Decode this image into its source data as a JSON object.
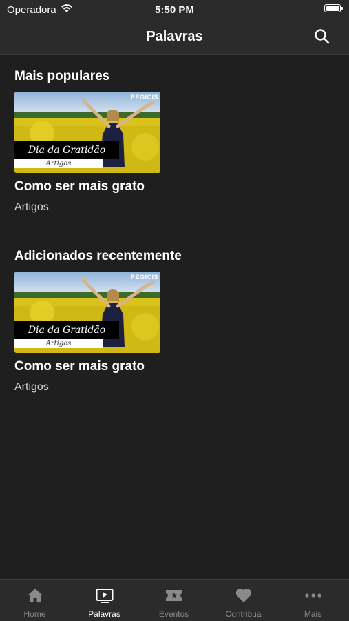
{
  "status_bar": {
    "carrier": "Operadora",
    "time": "5:50 PM"
  },
  "nav": {
    "title": "Palavras",
    "search_icon": "search-icon"
  },
  "sections": [
    {
      "title": "Mais populares",
      "items": [
        {
          "title": "Como ser mais grato",
          "category": "Artigos",
          "thumb_banner": "Dia da Gratidão",
          "thumb_sub": "Artigos",
          "thumb_logo": "PEGICIS"
        }
      ]
    },
    {
      "title": "Adicionados recentemente",
      "items": [
        {
          "title": "Como ser mais grato",
          "category": "Artigos",
          "thumb_banner": "Dia da Gratidão",
          "thumb_sub": "Artigos",
          "thumb_logo": "PEGICIS"
        }
      ]
    }
  ],
  "tab_bar": {
    "active": "Palavras",
    "tabs": [
      {
        "label": "Home",
        "icon": "home-icon"
      },
      {
        "label": "Palavras",
        "icon": "play-screen-icon"
      },
      {
        "label": "Eventos",
        "icon": "ticket-icon"
      },
      {
        "label": "Contribua",
        "icon": "heart-icon"
      },
      {
        "label": "Mais",
        "icon": "more-dots-icon"
      }
    ]
  },
  "colors": {
    "background": "#1f1f1f",
    "bar": "#2b2b2b",
    "active_tab": "#ffffff",
    "inactive_tab": "#8a8a8a"
  }
}
